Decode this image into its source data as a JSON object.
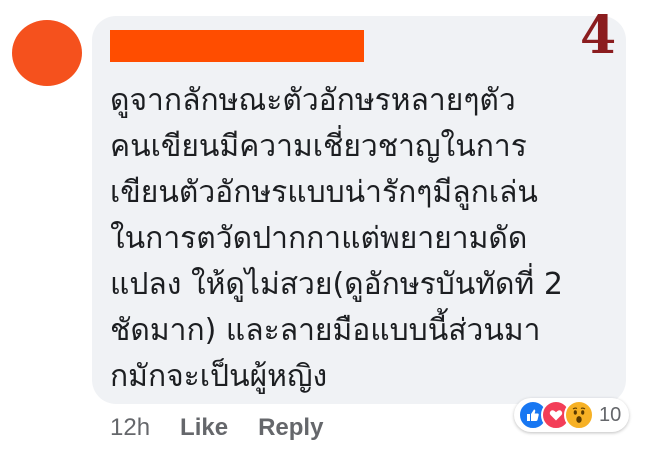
{
  "avatar_color": "#f5511d",
  "redaction_color": "#ff4d00",
  "bubble_color": "#f0f2f5",
  "badge": {
    "number": "4",
    "color": "#8b1d1f"
  },
  "comment": {
    "lines": [
      "ดูจากลักษณะตัวอักษรหลายๆตัว",
      "คนเขียนมีความเชี่ยวชาญในการ",
      "เขียนตัวอักษรแบบน่ารักๆมีลูกเล่น",
      "ในการตวัดปากกาแต่พยายามดัด",
      "แปลง ให้ดูไม่สวย(ดูอักษรบันทัดที่ 2",
      "ชัดมาก) และลายมือแบบนี้ส่วนมา",
      "กมักจะเป็นผู้หญิง"
    ]
  },
  "actions": {
    "time": "12h",
    "like_label": "Like",
    "reply_label": "Reply"
  },
  "reactions": {
    "icons": [
      "like-icon",
      "love-icon",
      "wow-icon"
    ],
    "count": "10",
    "colors": {
      "like": "#1877f2",
      "love": "#f33e58",
      "wow": "#f7b125"
    }
  }
}
